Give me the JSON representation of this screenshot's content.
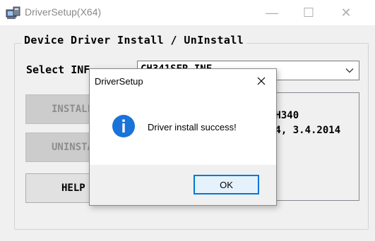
{
  "window": {
    "title": "DriverSetup(X64)",
    "minimize_glyph": "—",
    "maximize_glyph": "☐",
    "close_glyph": "✕"
  },
  "group": {
    "title": "Device Driver Install / UnInstall"
  },
  "select_inf": {
    "label": "Select INF",
    "value": "CH341SER.INF"
  },
  "buttons": {
    "install": "INSTALL",
    "uninstall": "UNINSTALL",
    "help": "HELP"
  },
  "driver_info": {
    "line1": "CH340",
    "line2": "14, 3.4.2014"
  },
  "dialog": {
    "title": "DriverSetup",
    "message": "Driver install success!",
    "ok_label": "OK"
  },
  "colors": {
    "info_icon": "#1a73d9",
    "ok_border": "#0078d7"
  }
}
